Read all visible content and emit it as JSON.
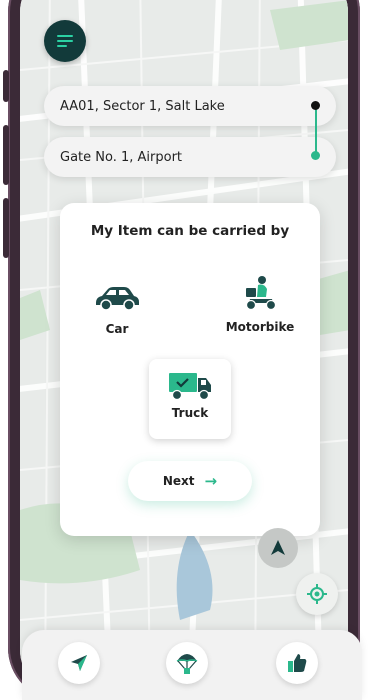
{
  "locations": {
    "pickup": "AA01, Sector 1, Salt Lake",
    "drop": "Gate No. 1, Airport"
  },
  "modal": {
    "title": "My Item can be carried by",
    "vehicles": [
      {
        "label": "Car",
        "icon": "car-icon",
        "selected": false
      },
      {
        "label": "Motorbike",
        "icon": "motorbike-icon",
        "selected": false
      },
      {
        "label": "Truck",
        "icon": "truck-icon",
        "selected": true
      }
    ],
    "next_label": "Next",
    "next_icon": "arrow-right-icon"
  },
  "map_controls": {
    "nav_marker_icon": "navigation-marker-icon",
    "locate_icon": "crosshair-icon"
  },
  "bottom_nav": [
    {
      "icon": "navigation-arrow-icon"
    },
    {
      "icon": "parachute-icon"
    },
    {
      "icon": "thumbs-up-icon"
    }
  ],
  "colors": {
    "accent": "#2bb88c",
    "dark": "#123a3a",
    "vehicle_teal": "#1f4a4a"
  }
}
